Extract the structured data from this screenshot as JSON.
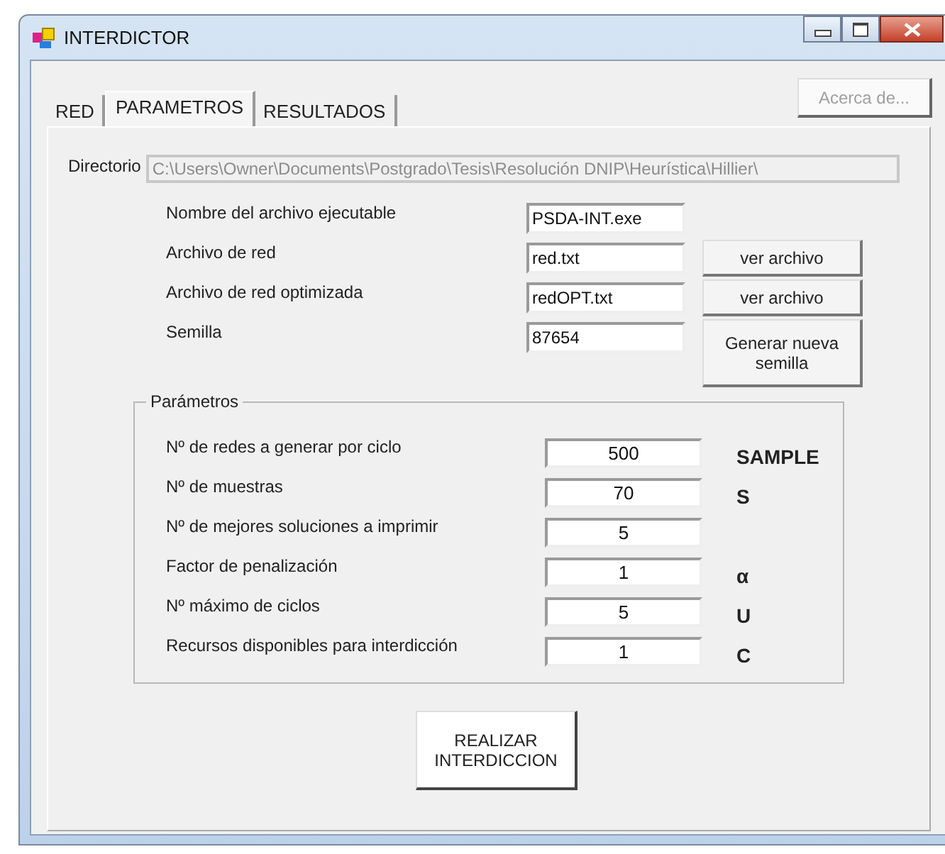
{
  "window": {
    "title": "INTERDICTOR"
  },
  "about_button": {
    "label": "Acerca de...",
    "disabled": true
  },
  "tabs": [
    {
      "label": "RED",
      "selected": false
    },
    {
      "label": "PARAMETROS",
      "selected": true
    },
    {
      "label": "RESULTADOS",
      "selected": false
    }
  ],
  "directory": {
    "label": "Directorio",
    "value": "C:\\Users\\Owner\\Documents\\Postgrado\\Tesis\\Resolución DNIP\\Heurística\\Hillier\\",
    "disabled": true
  },
  "files": [
    {
      "label": "Nombre del archivo ejecutable",
      "value": "PSDA-INT.exe"
    },
    {
      "label": "Archivo de red",
      "value": "red.txt",
      "button": "ver archivo"
    },
    {
      "label": "Archivo de red optimizada",
      "value": "redOPT.txt",
      "button": "ver archivo"
    },
    {
      "label": "Semilla",
      "value": "87654",
      "button": "Generar nueva semilla"
    }
  ],
  "parameters": {
    "title": "Parámetros",
    "rows": [
      {
        "label": "Nº de redes a generar por ciclo",
        "value": "500",
        "symbol": "SAMPLE"
      },
      {
        "label": "Nº de muestras",
        "value": "70",
        "symbol": "S"
      },
      {
        "label": "Nº de mejores soluciones a imprimir",
        "value": "5"
      },
      {
        "label": "Factor de penalización",
        "value": "1",
        "symbol": "α"
      },
      {
        "label": "Nº máximo de ciclos",
        "value": "5",
        "symbol": "U"
      },
      {
        "label": "Recursos disponibles para interdicción",
        "value": "1",
        "symbol": "C"
      }
    ]
  },
  "run_button": {
    "label": "REALIZAR INTERDICCION"
  }
}
